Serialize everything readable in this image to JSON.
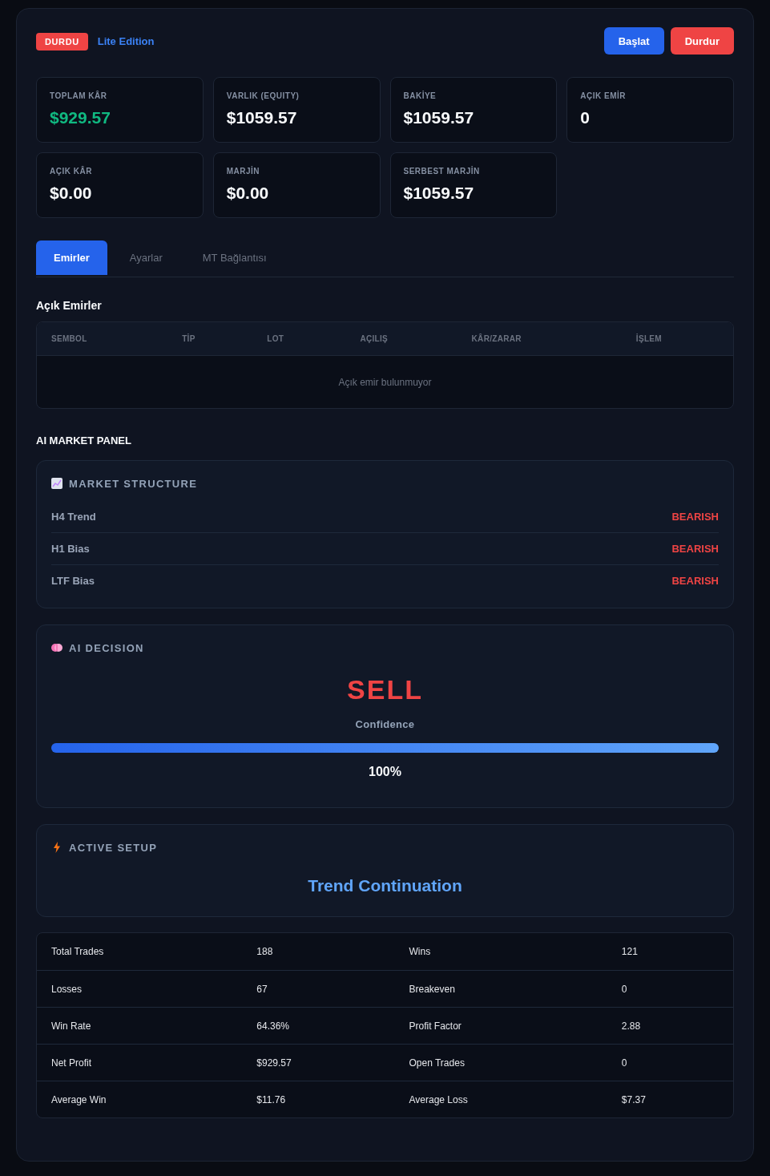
{
  "header": {
    "status": {
      "label": "DURDU",
      "running": false
    },
    "edition": "Lite Edition",
    "buttons": [
      {
        "label": "Başlat",
        "kind": "primary"
      },
      {
        "label": "Durdur",
        "kind": "danger"
      }
    ]
  },
  "account_stats": [
    {
      "label": "TOPLAM KÂR",
      "value": "$929.57",
      "kind": "profit"
    },
    {
      "label": "VARLIK (EQUITY)",
      "value": "$1059.57",
      "kind": "plain"
    },
    {
      "label": "BAKİYE",
      "value": "$1059.57",
      "kind": "plain"
    },
    {
      "label": "AÇIK EMİR",
      "value": "0",
      "kind": "plain"
    },
    {
      "label": "AÇIK KÂR",
      "value": "$0.00",
      "kind": "plain"
    },
    {
      "label": "MARJİN",
      "value": "$0.00",
      "kind": "plain"
    },
    {
      "label": "SERBEST MARJİN",
      "value": "$1059.57",
      "kind": "plain"
    }
  ],
  "tabs": [
    {
      "label": "Emirler",
      "selected": true
    },
    {
      "label": "Ayarlar",
      "selected": false
    },
    {
      "label": "MT Bağlantısı",
      "selected": false
    }
  ],
  "open_orders": {
    "title": "Açık Emirler",
    "columns": [
      "SEMBOL",
      "TİP",
      "LOT",
      "AÇILIŞ",
      "KÂR/ZARAR",
      "İŞLEM"
    ],
    "empty_message": "Açık emir bulunmuyor"
  },
  "ai_market_panel": {
    "title": "AI MARKET PANEL",
    "market_structure": {
      "title": "MARKET STRUCTURE",
      "rows": [
        {
          "label": "H4 Trend",
          "value": "BEARISH",
          "kind": "bearish"
        },
        {
          "label": "H1 Bias",
          "value": "BEARISH",
          "kind": "bearish"
        },
        {
          "label": "LTF Bias",
          "value": "BEARISH",
          "kind": "bearish"
        }
      ]
    },
    "ai_decision": {
      "title": "AI DECISION",
      "signal": "SELL",
      "kind": "sell",
      "confidence_label": "Confidence",
      "level": 1,
      "reading": "100%"
    },
    "active_setup": {
      "title": "ACTIVE SETUP",
      "name": "Trend Continuation"
    }
  },
  "performance": {
    "rows": [
      [
        "Total Trades",
        "188",
        "Wins",
        "121"
      ],
      [
        "Losses",
        "67",
        "Breakeven",
        "0"
      ],
      [
        "Win Rate",
        "64.36%",
        "Profit Factor",
        "2.88"
      ],
      [
        "Net Profit",
        "$929.57",
        "Open Trades",
        "0"
      ],
      [
        "Average Win",
        "$11.76",
        "Average Loss",
        "$7.37"
      ]
    ]
  }
}
